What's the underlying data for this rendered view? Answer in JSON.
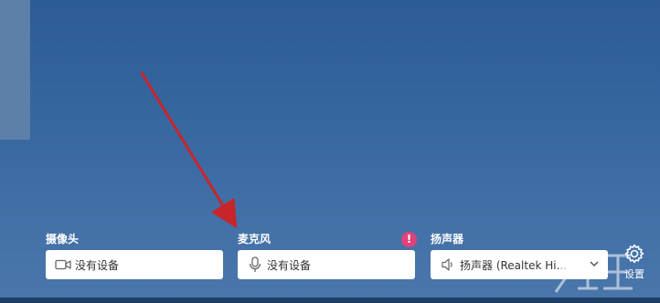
{
  "devices": {
    "camera": {
      "label": "摄像头",
      "value": "没有设备",
      "icon": "video-camera-icon"
    },
    "microphone": {
      "label": "麦克风",
      "value": "没有设备",
      "icon": "microphone-icon",
      "alert": "!"
    },
    "speaker": {
      "label": "扬声器",
      "value": "扬声器 (Realtek Hi...",
      "icon": "speaker-icon"
    }
  },
  "settings": {
    "label": "设置",
    "icon": "gear-icon"
  },
  "annotation": {
    "arrow_color": "#c8252b"
  },
  "colors": {
    "background": "#3a69a1",
    "alert": "#e0427a"
  }
}
